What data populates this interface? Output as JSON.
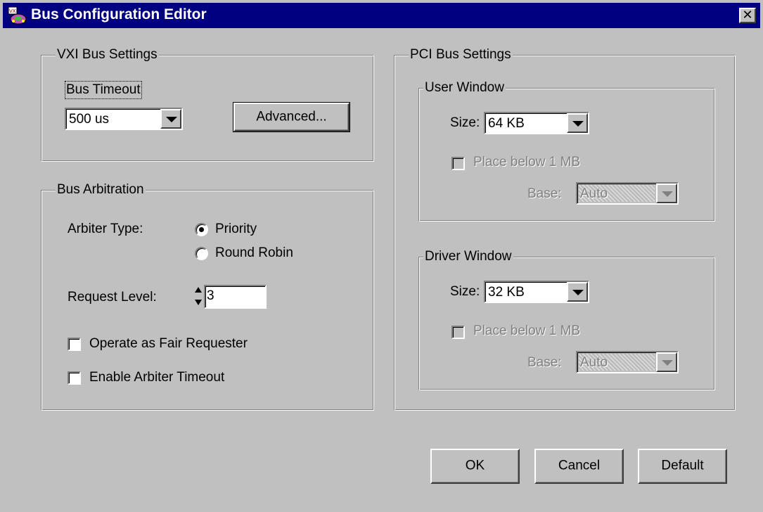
{
  "window": {
    "title": "Bus Configuration Editor",
    "close_label": "✕"
  },
  "vxi": {
    "group_label": "VXI Bus Settings",
    "timeout_label": "Bus Timeout",
    "timeout_value": "500 us",
    "advanced_label": "Advanced..."
  },
  "arbitration": {
    "group_label": "Bus Arbitration",
    "arbiter_type_label": "Arbiter Type:",
    "options": [
      "Priority",
      "Round Robin"
    ],
    "selected": "Priority",
    "request_level_label": "Request Level:",
    "request_level_value": "3",
    "fair_requester_label": "Operate as Fair Requester",
    "fair_requester_checked": false,
    "arbiter_timeout_label": "Enable Arbiter Timeout",
    "arbiter_timeout_checked": false
  },
  "pci": {
    "group_label": "PCI Bus Settings",
    "user_window": {
      "group_label": "User Window",
      "size_label": "Size:",
      "size_value": "64 KB",
      "below_1mb_label": "Place below 1 MB",
      "base_label": "Base:",
      "base_value": "Auto"
    },
    "driver_window": {
      "group_label": "Driver Window",
      "size_label": "Size:",
      "size_value": "32 KB",
      "below_1mb_label": "Place below 1 MB",
      "base_label": "Base:",
      "base_value": "Auto"
    }
  },
  "buttons": {
    "ok": "OK",
    "cancel": "Cancel",
    "default": "Default"
  },
  "colors": {
    "titlebar": "#000080",
    "face": "#c0c0c0"
  }
}
